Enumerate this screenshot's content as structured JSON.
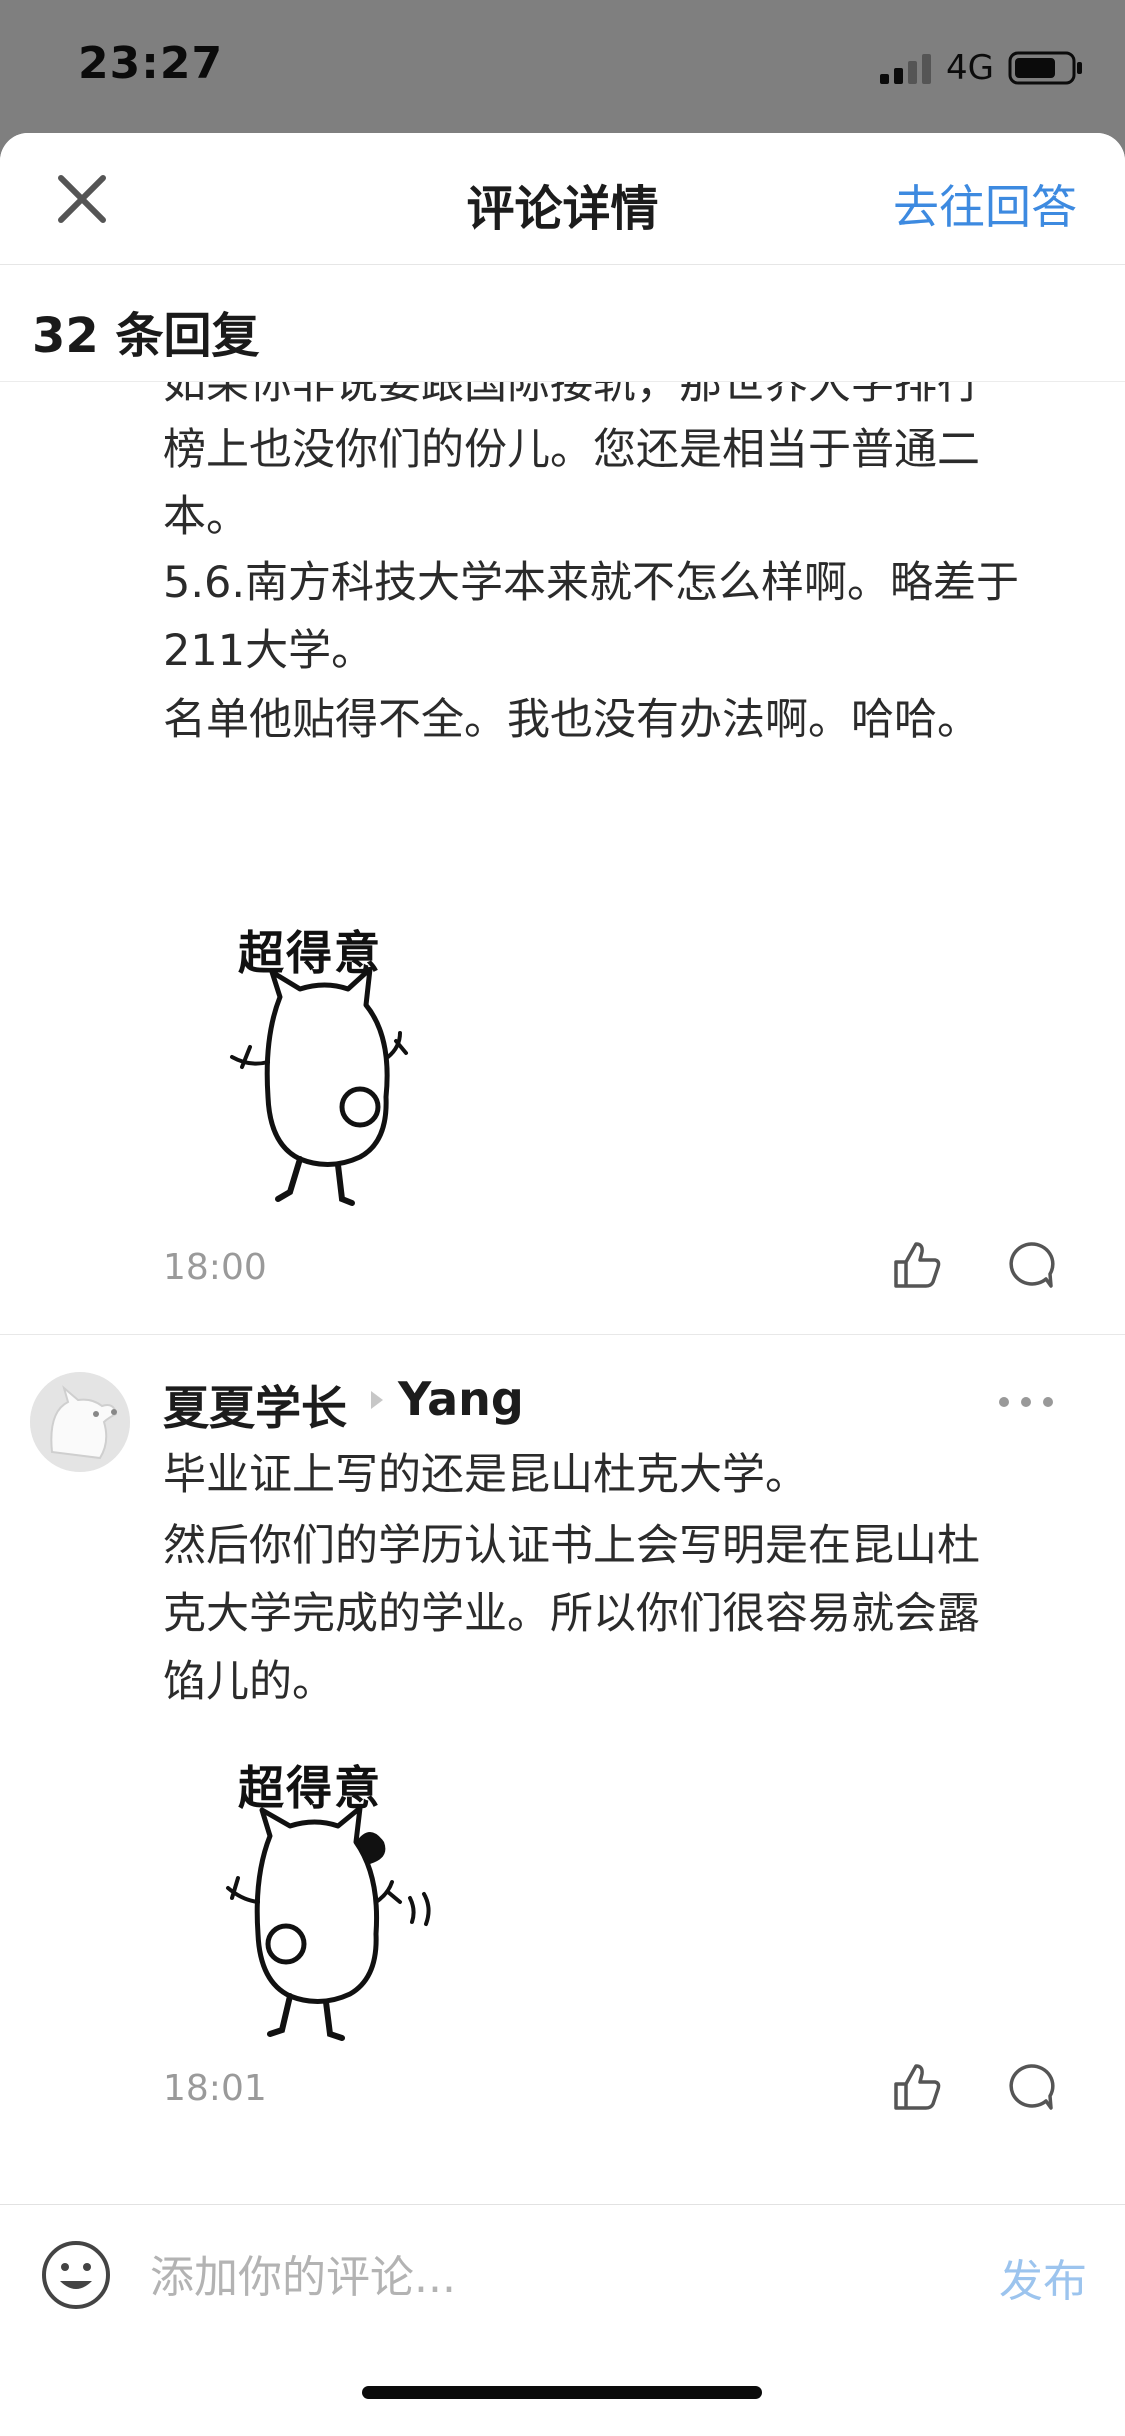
{
  "status_bar": {
    "time": "23:27",
    "network": "4G",
    "icons": [
      "signal-icon",
      "battery-icon"
    ]
  },
  "nav": {
    "title": "评论详情",
    "action": "去往回答",
    "close_icon": "close-icon"
  },
  "reply_count": "32 条回复",
  "comments": [
    {
      "lines": [
        "如果你非说要跟国际接轨，那世界大学排行",
        "榜上也没你们的份儿。您还是相当于普通二",
        "本。",
        "5.6.南方科技大学本来就不怎么样啊。略差于",
        "211大学。",
        "名单他贴得不全。我也没有办法啊。哈哈。"
      ],
      "sticker_caption": "超得意",
      "time": "18:00"
    },
    {
      "author": "夏夏学长",
      "reply_to": "Yang",
      "lines": [
        "毕业证上写的还是昆山杜克大学。",
        "然后你们的学历认证书上会写明是在昆山杜",
        "克大学完成的学业。所以你们很容易就会露",
        "馅儿的。"
      ],
      "sticker_caption": "超得意",
      "time": "18:01"
    }
  ],
  "input_bar": {
    "placeholder": "添加你的评论...",
    "publish": "发布",
    "emoji_icon": "emoji-icon"
  },
  "colors": {
    "accent": "#3d8ae0",
    "publish_disabled": "#9cc4ee",
    "status_bar_bg": "#7f7f7f",
    "timestamp": "#9a9a9a"
  }
}
